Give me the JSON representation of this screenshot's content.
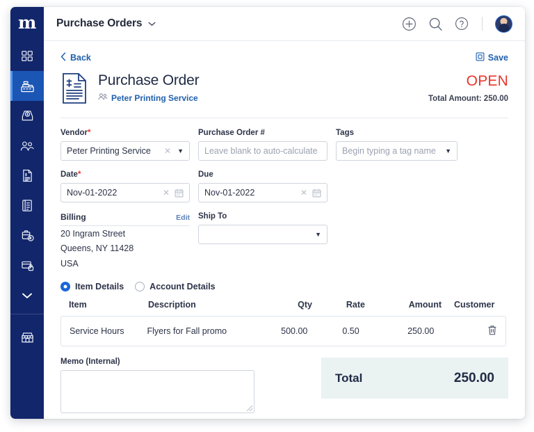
{
  "app": {
    "logo_text": "m"
  },
  "sidebar": {
    "items": [
      {
        "name": "dashboard",
        "icon": "grid-icon",
        "active": false
      },
      {
        "name": "sales",
        "icon": "cash-register-icon",
        "active": true
      },
      {
        "name": "expenses",
        "icon": "money-inbox-icon",
        "active": false
      },
      {
        "name": "contacts",
        "icon": "people-icon",
        "active": false
      },
      {
        "name": "invoices",
        "icon": "document-dollar-icon",
        "active": false
      },
      {
        "name": "reports",
        "icon": "ledger-icon",
        "active": false
      },
      {
        "name": "payroll",
        "icon": "briefcase-dollar-icon",
        "active": false
      },
      {
        "name": "banking",
        "icon": "card-lock-icon",
        "active": false
      },
      {
        "name": "more",
        "icon": "chevron-down-icon",
        "active": false
      }
    ],
    "footer_item": {
      "name": "marketplace",
      "icon": "store-icon"
    }
  },
  "topbar": {
    "title": "Purchase Orders",
    "caret_icon": "chevron-down-icon",
    "add_icon": "plus-circle-icon",
    "search_icon": "search-icon",
    "help_icon": "question-circle-icon",
    "avatar_icon": "avatar"
  },
  "toolbar": {
    "back_label": "Back",
    "back_icon": "chevron-left-icon",
    "save_label": "Save",
    "save_icon": "save-disk-icon"
  },
  "header": {
    "doc_icon": "document-dollar-icon",
    "title": "Purchase Order",
    "vendor_icon": "people-icon",
    "vendor_name": "Peter Printing Service",
    "status": "OPEN",
    "status_color": "#e8352a",
    "total_amount_label": "Total Amount:  250.00"
  },
  "form": {
    "vendor": {
      "label": "Vendor",
      "required": true,
      "value": "Peter Printing Service",
      "clear_icon": "close-icon",
      "caret_icon": "caret-down-icon"
    },
    "purchase_order_number": {
      "label": "Purchase Order #",
      "placeholder": "Leave blank to auto-calculate",
      "value": ""
    },
    "tags": {
      "label": "Tags",
      "placeholder": "Begin typing a tag name",
      "caret_icon": "caret-down-icon"
    },
    "date": {
      "label": "Date",
      "required": true,
      "value": "Nov-01-2022",
      "clear_icon": "close-icon",
      "calendar_icon": "calendar-icon"
    },
    "due": {
      "label": "Due",
      "required": false,
      "value": "Nov-01-2022",
      "clear_icon": "close-icon",
      "calendar_icon": "calendar-icon"
    },
    "billing": {
      "label": "Billing",
      "edit_label": "Edit",
      "address_lines": [
        "20 Ingram Street",
        "Queens, NY 11428",
        "USA"
      ]
    },
    "ship_to": {
      "label": "Ship To",
      "value": "",
      "caret_icon": "caret-down-icon"
    },
    "memo": {
      "label": "Memo (Internal)",
      "value": ""
    }
  },
  "details_mode": {
    "options": [
      {
        "label": "Item Details",
        "selected": true
      },
      {
        "label": "Account Details",
        "selected": false
      }
    ]
  },
  "line_items_table": {
    "columns": [
      "Item",
      "Description",
      "Qty",
      "Rate",
      "Amount",
      "Customer"
    ],
    "rows": [
      {
        "item": "Service Hours",
        "description": "Flyers for Fall promo",
        "qty": "500.00",
        "rate": "0.50",
        "amount": "250.00",
        "customer": "",
        "delete_icon": "trash-icon"
      }
    ]
  },
  "totals": {
    "label": "Total",
    "value": "250.00"
  },
  "colors": {
    "sidebar_bg": "#12266b",
    "sidebar_active": "#1b56b5",
    "link_blue": "#2060ad",
    "status_red": "#e8352a",
    "total_panel_bg": "#eaf2f2"
  }
}
